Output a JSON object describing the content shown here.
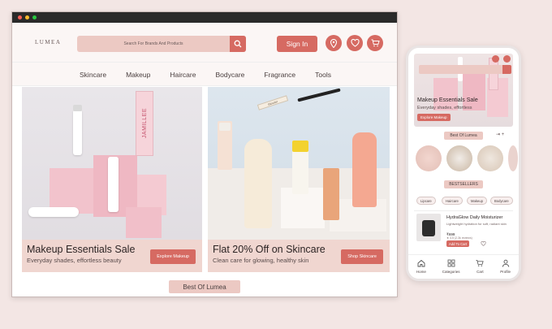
{
  "desktop": {
    "logo": "LUMEA",
    "search_placeholder": "Search For Brands And Products",
    "sign_in": "Sign In",
    "nav": [
      "Skincare",
      "Makeup",
      "Haircare",
      "Bodycare",
      "Fragrance",
      "Tools"
    ],
    "banners": [
      {
        "title": "Makeup Essentials Sale",
        "subtitle": "Everyday shades, effortless beauty",
        "button": "Explore Makeup"
      },
      {
        "title": "Flat 20% Off on Skincare",
        "subtitle": "Clean care for glowing, healthy skin",
        "button": "Shop Skincare"
      }
    ],
    "best_of": "Best Of Lumea",
    "product_text": {
      "jamillee": "JAMILLEE",
      "glossier": "Glossier"
    }
  },
  "mobile": {
    "hero_title": "Makeup Essentials Sale",
    "hero_subtitle": "Everyday shades, effortless",
    "hero_button": "Explore Makeup",
    "best_of": "Best Of Lumea",
    "bestsellers": "BESTSELLERS",
    "chips": [
      "Lipcare",
      "Haircare",
      "Makeup",
      "Bodycare"
    ],
    "product": {
      "name": "HydraGlow Daily Moisturizer",
      "desc": "Lightweight hydration for soft, radiant skin",
      "price": "₹699",
      "rating": "★ 4.5 (2.3k reviews)",
      "add": "Add To Cart"
    },
    "tabs": [
      "Home",
      "Categories",
      "Cart",
      "Profile"
    ]
  },
  "colors": {
    "accent": "#d66a62",
    "soft_pink": "#ecc9c3",
    "background": "#f3e6e4"
  }
}
